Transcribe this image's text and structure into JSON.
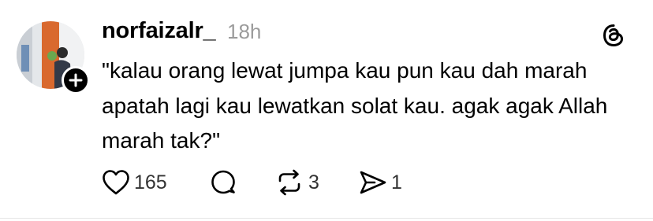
{
  "post": {
    "username": "norfaizalr_",
    "timestamp": "18h",
    "text": "\"kalau orang lewat jumpa kau pun kau dah marah apatah lagi kau lewatkan solat kau. agak agak Allah marah tak?\"",
    "likes": "165",
    "reposts": "3",
    "shares": "1"
  },
  "icons": {
    "avatar": "profile-photo",
    "follow": "plus-icon",
    "brand": "threads-logo-icon",
    "like": "heart-icon",
    "comment": "comment-bubble-icon",
    "repost": "repost-icon",
    "share": "send-icon"
  },
  "colors": {
    "text": "#000000",
    "muted": "#9b9b9b",
    "counts": "#333333",
    "divider": "#e6e6e6"
  }
}
